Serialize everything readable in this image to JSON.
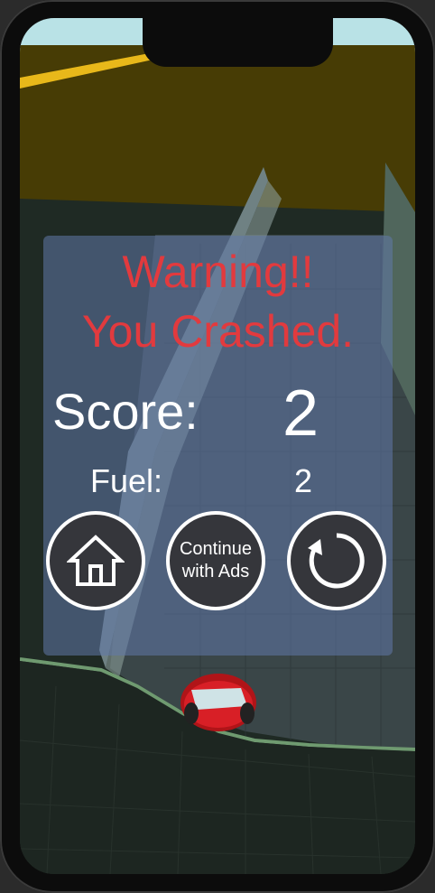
{
  "game_over_panel": {
    "warning_line1": "Warning!!",
    "warning_line2": "You Crashed.",
    "score_label": "Score:",
    "score_value": "2",
    "fuel_label": "Fuel:",
    "fuel_value": "2"
  },
  "buttons": {
    "home_icon": "home-icon",
    "continue_label_line1": "Continue",
    "continue_label_line2": "with Ads",
    "restart_icon": "restart-icon"
  },
  "colors": {
    "warning_text": "#e23a3e",
    "panel_bg": "#6078aa",
    "button_bg": "#35363b",
    "button_border": "#ffffff",
    "ground": "#4a3f06",
    "road_marking": "#e8b81a",
    "car": "#d81f26"
  }
}
